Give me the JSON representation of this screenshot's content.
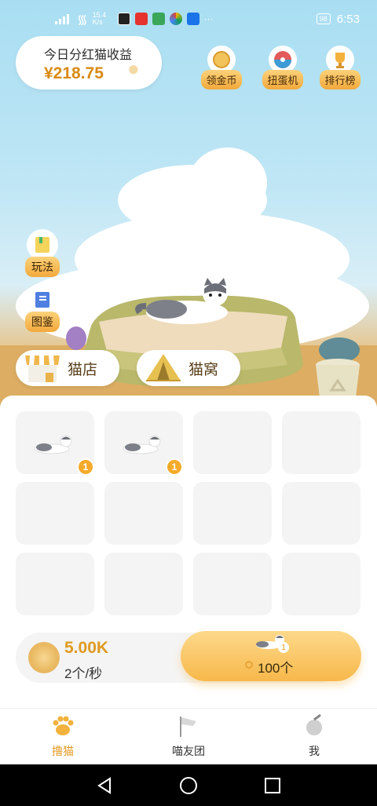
{
  "status_bar": {
    "net_speed_value": "15.4",
    "net_speed_unit": "K/s",
    "battery": "98",
    "time": "6:53"
  },
  "earnings": {
    "label": "今日分红猫收益",
    "value": "¥218.75"
  },
  "top_buttons": [
    {
      "label": "领金币",
      "icon": "gold-coin-icon"
    },
    {
      "label": "扭蛋机",
      "icon": "gacha-machine-icon"
    },
    {
      "label": "排行榜",
      "icon": "trophy-icon"
    }
  ],
  "side_buttons": [
    {
      "label": "玩法",
      "icon": "rulebook-icon"
    },
    {
      "label": "图鉴",
      "icon": "catalog-icon"
    }
  ],
  "shop_buttons": [
    {
      "label": "猫店",
      "icon": "storefront-icon"
    },
    {
      "label": "猫窝",
      "icon": "tent-icon"
    }
  ],
  "cat_slots": [
    {
      "level": "1",
      "filled": true
    },
    {
      "level": "1",
      "filled": true
    },
    {
      "filled": false
    },
    {
      "filled": false
    },
    {
      "filled": false
    },
    {
      "filled": false
    },
    {
      "filled": false
    },
    {
      "filled": false
    },
    {
      "filled": false
    },
    {
      "filled": false
    },
    {
      "filled": false
    },
    {
      "filled": false
    }
  ],
  "coins": {
    "total": "5.00K",
    "rate": "2个/秒"
  },
  "buy": {
    "level": "1",
    "price": "100个"
  },
  "tabs": [
    {
      "label": "撸猫",
      "active": true
    },
    {
      "label": "喵友团",
      "active": false
    },
    {
      "label": "我",
      "active": false
    }
  ],
  "colors": {
    "accent": "#F4AA2B",
    "sky": "#A9DEF2",
    "floor": "#D7AA63"
  }
}
